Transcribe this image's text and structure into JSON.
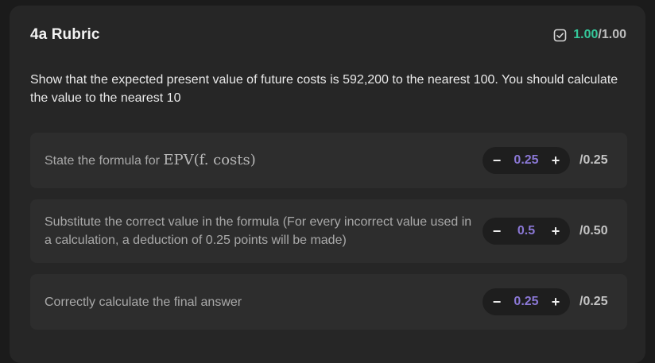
{
  "rubric": {
    "title": "4a Rubric",
    "score_obtained": "1.00",
    "score_max": "/1.00",
    "description": "Show that the expected present value of future costs is 592,200 to the nearest 100. You should calculate the value to the nearest 10",
    "accent_color": "#35c79a",
    "value_color": "#8b78d6"
  },
  "criteria": [
    {
      "label": "State the formula for ",
      "math": "EPV(f. costs)",
      "value": "0.25",
      "max": "/0.25",
      "minus_label": "−",
      "plus_label": "+"
    },
    {
      "label": "Substitute the correct value in the formula (For every incorrect value used in a calculation, a deduction of 0.25 points will be made)",
      "value": "0.5",
      "max": "/0.50",
      "minus_label": "−",
      "plus_label": "+"
    },
    {
      "label": "Correctly calculate the final answer",
      "value": "0.25",
      "max": "/0.25",
      "minus_label": "−",
      "plus_label": "+"
    }
  ]
}
